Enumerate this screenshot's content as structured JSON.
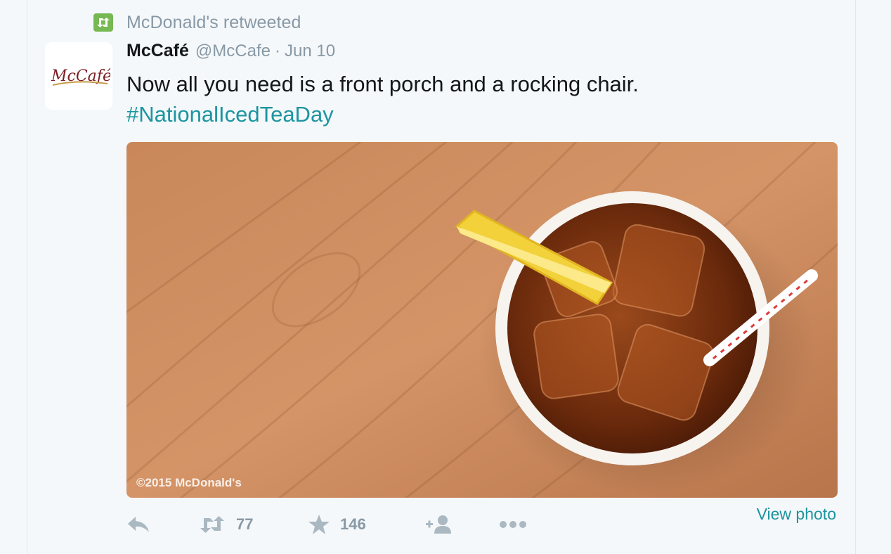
{
  "retweet_context": {
    "text": "McDonald's retweeted",
    "icon": "retweet-icon",
    "badge_color": "#76b852"
  },
  "tweet": {
    "avatar_text": "McCafé",
    "fullname": "McCafé",
    "screen_name": "@McCafe",
    "separator": "·",
    "date": "Jun 10",
    "text": "Now all you need is a front porch and a rocking chair.",
    "hashtag": "#NationalIcedTeaDay",
    "photo_copyright": "©2015 McDonald's",
    "view_photo_label": "View photo"
  },
  "actions": {
    "reply": {
      "icon": "reply-icon"
    },
    "retweet": {
      "icon": "retweet-icon",
      "count": "77"
    },
    "favorite": {
      "icon": "star-icon",
      "count": "146"
    },
    "follow": {
      "icon": "follow-icon"
    },
    "more": {
      "icon": "more-icon"
    }
  },
  "colors": {
    "link": "#1b95a0",
    "muted": "#8899a6",
    "icon_gray": "#aab8c2"
  }
}
